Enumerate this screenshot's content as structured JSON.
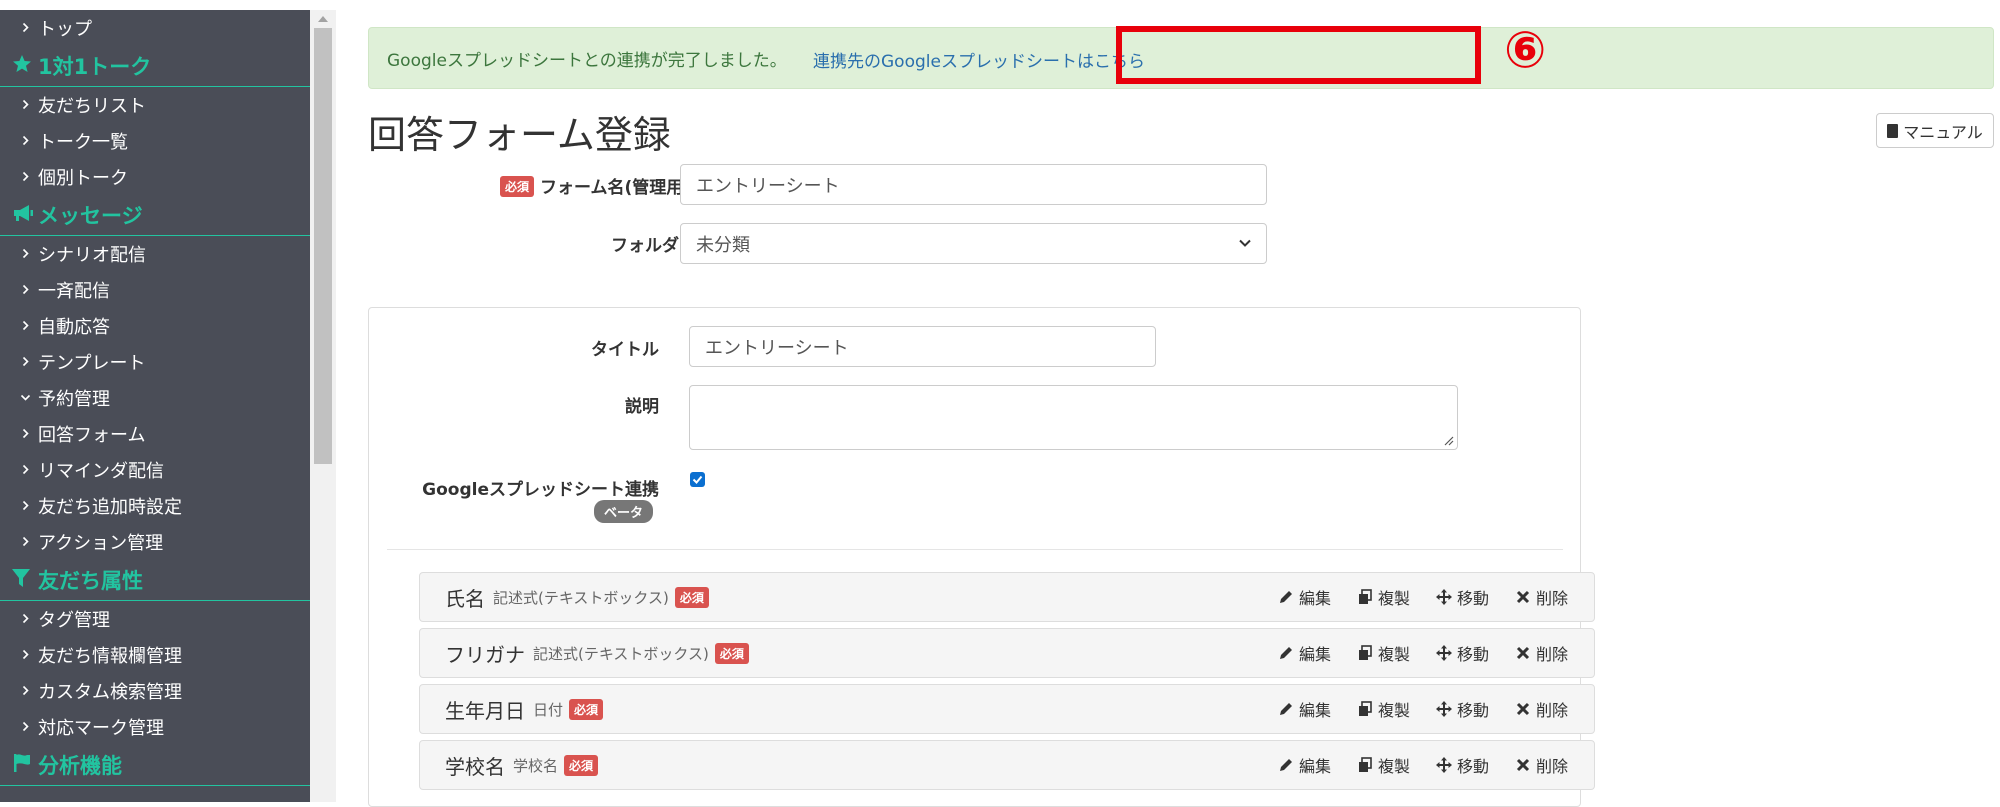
{
  "sidebar": {
    "items": [
      {
        "type": "item",
        "label": "トップ",
        "chev": "›"
      },
      {
        "type": "head",
        "label": "1対1トーク",
        "icon": "star-icon"
      },
      {
        "type": "item",
        "label": "友だちリスト",
        "chev": "›"
      },
      {
        "type": "item",
        "label": "トーク一覧",
        "chev": "›"
      },
      {
        "type": "item",
        "label": "個別トーク",
        "chev": "›"
      },
      {
        "type": "head",
        "label": "メッセージ",
        "icon": "megaphone-icon"
      },
      {
        "type": "item",
        "label": "シナリオ配信",
        "chev": "›"
      },
      {
        "type": "item",
        "label": "一斉配信",
        "chev": "›"
      },
      {
        "type": "item",
        "label": "自動応答",
        "chev": "›"
      },
      {
        "type": "item",
        "label": "テンプレート",
        "chev": "›"
      },
      {
        "type": "item",
        "label": "予約管理",
        "chev": "⌄"
      },
      {
        "type": "item",
        "label": "回答フォーム",
        "chev": "›"
      },
      {
        "type": "item",
        "label": "リマインダ配信",
        "chev": "›"
      },
      {
        "type": "item",
        "label": "友だち追加時設定",
        "chev": "›"
      },
      {
        "type": "item",
        "label": "アクション管理",
        "chev": "›"
      },
      {
        "type": "head",
        "label": "友だち属性",
        "icon": "filter-icon"
      },
      {
        "type": "item",
        "label": "タグ管理",
        "chev": "›"
      },
      {
        "type": "item",
        "label": "友だち情報欄管理",
        "chev": "›"
      },
      {
        "type": "item",
        "label": "カスタム検索管理",
        "chev": "›"
      },
      {
        "type": "item",
        "label": "対応マーク管理",
        "chev": "›"
      },
      {
        "type": "head",
        "label": "分析機能",
        "icon": "flag-icon"
      }
    ]
  },
  "alert": {
    "text": "Googleスプレッドシートとの連携が完了しました。",
    "link": "連携先のGoogleスプレッドシートはこちら"
  },
  "annotation": {
    "step": "⑥",
    "color": "#e8000a"
  },
  "page": {
    "title": "回答フォーム登録",
    "manual_button": "マニュアル"
  },
  "form": {
    "required_badge": "必須",
    "name_label": "フォーム名(管理用)",
    "name_value": "エントリーシート",
    "folder_label": "フォルダ",
    "folder_value": "未分類",
    "title_label": "タイトル",
    "title_value": "エントリーシート",
    "description_label": "説明",
    "description_value": "",
    "sheets_label": "Googleスプレッドシート連携",
    "sheets_checked": true,
    "beta_badge": "ベータ"
  },
  "fields": [
    {
      "name": "氏名",
      "type": "記述式(テキストボックス)",
      "required": "必須"
    },
    {
      "name": "フリガナ",
      "type": "記述式(テキストボックス)",
      "required": "必須"
    },
    {
      "name": "生年月日",
      "type": "日付",
      "required": "必須"
    },
    {
      "name": "学校名",
      "type": "学校名",
      "required": "必須"
    }
  ],
  "field_actions": {
    "edit": "編集",
    "copy": "複製",
    "move": "移動",
    "delete": "削除"
  },
  "colors": {
    "accent": "#22c4a0",
    "sidebar_bg": "#4a4d57",
    "alert_bg": "#dff0d8",
    "required": "#d9534f"
  }
}
